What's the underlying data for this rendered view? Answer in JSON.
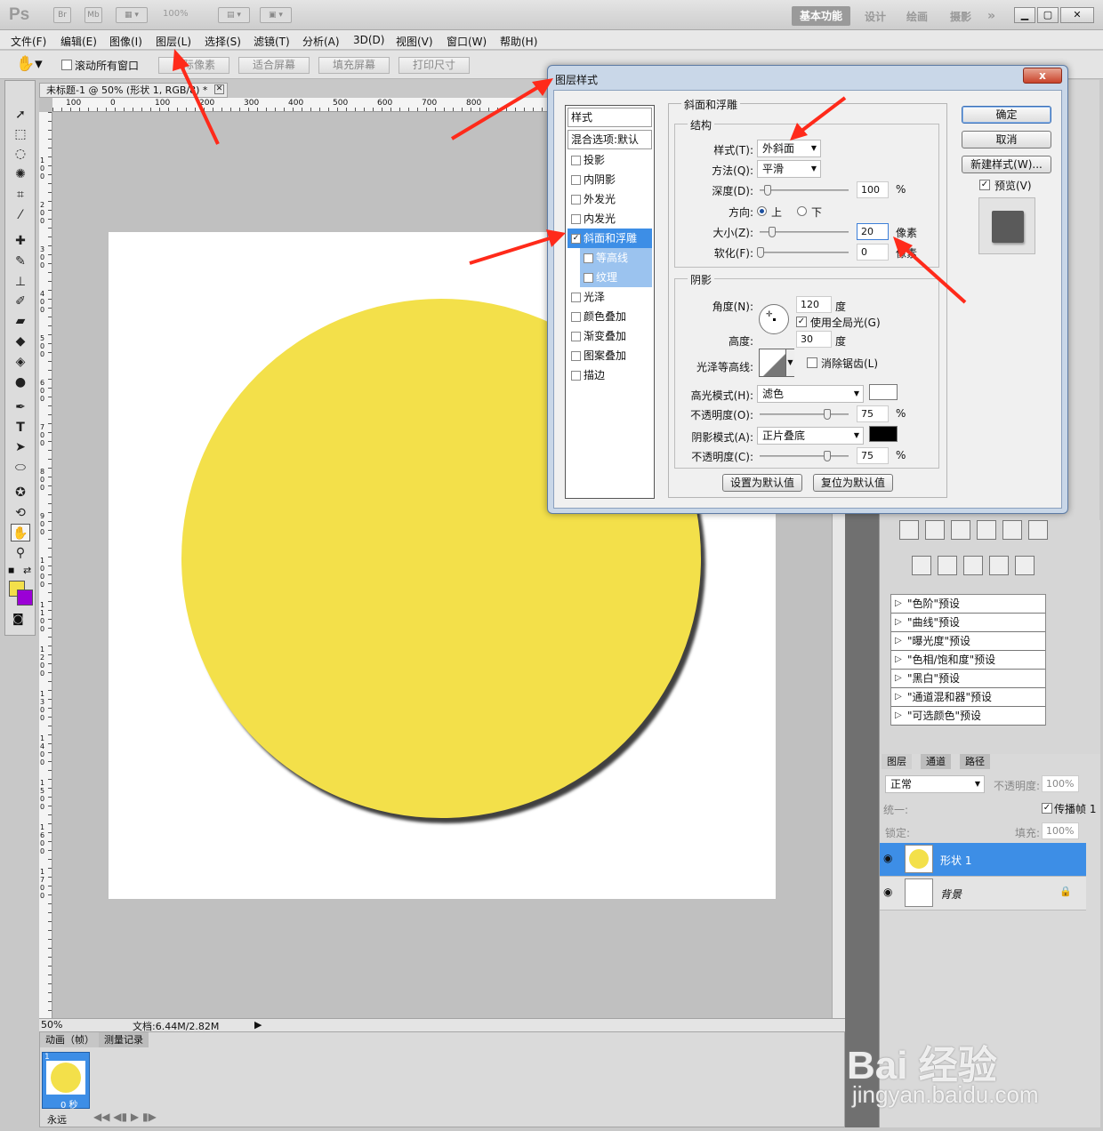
{
  "app": {
    "logo": "Ps",
    "bridge": "Br",
    "minibridge": "Mb",
    "zoom": "100%",
    "workspaces": [
      "基本功能",
      "设计",
      "绘画",
      "摄影"
    ],
    "more": "»"
  },
  "menu": [
    "文件(F)",
    "编辑(E)",
    "图像(I)",
    "图层(L)",
    "选择(S)",
    "滤镜(T)",
    "分析(A)",
    "3D(D)",
    "视图(V)",
    "窗口(W)",
    "帮助(H)"
  ],
  "options": {
    "scroll_all": "滚动所有窗口",
    "actual_pixels": "实际像素",
    "fit_screen": "适合屏幕",
    "fill_screen": "填充屏幕",
    "print_size": "打印尺寸"
  },
  "document": {
    "tab_title": "未标题-1 @ 50% (形状 1, RGB/8) *",
    "h_ruler": [
      "100",
      "0",
      "100",
      "200",
      "300",
      "400",
      "500",
      "600",
      "700",
      "800"
    ],
    "v_ruler": [
      "1",
      "2",
      "3",
      "4",
      "5",
      "6",
      "7",
      "8",
      "9",
      "10",
      "11",
      "12",
      "13",
      "14",
      "15",
      "16",
      "17"
    ],
    "status_zoom": "50%",
    "status_doc": "文档:6.44M/2.82M"
  },
  "colors": {
    "foreground": "#f3e04a",
    "background": "#9b00d6",
    "accent": "#3d8ee6",
    "arrow": "#ff2a1a"
  },
  "animation": {
    "tab_animation": "动画（帧）",
    "tab_history": "测量记录",
    "frame_number": "1",
    "frame_time": "0 秒",
    "loop": "永远"
  },
  "dialog": {
    "title": "图层样式",
    "close": "x",
    "styles_header": "样式",
    "blend_options": "混合选项:默认",
    "styles": [
      {
        "label": "投影",
        "checked": false
      },
      {
        "label": "内阴影",
        "checked": false
      },
      {
        "label": "外发光",
        "checked": false
      },
      {
        "label": "内发光",
        "checked": false
      },
      {
        "label": "斜面和浮雕",
        "checked": true
      },
      {
        "label": "等高线",
        "checked": false
      },
      {
        "label": "纹理",
        "checked": false
      },
      {
        "label": "光泽",
        "checked": false
      },
      {
        "label": "颜色叠加",
        "checked": false
      },
      {
        "label": "渐变叠加",
        "checked": false
      },
      {
        "label": "图案叠加",
        "checked": false
      },
      {
        "label": "描边",
        "checked": false
      }
    ],
    "section_title": "斜面和浮雕",
    "structure": {
      "legend": "结构",
      "style_label": "样式(T):",
      "style_value": "外斜面",
      "method_label": "方法(Q):",
      "method_value": "平滑",
      "depth_label": "深度(D):",
      "depth_value": "100",
      "percent": "%",
      "direction_label": "方向:",
      "direction_up": "上",
      "direction_down": "下",
      "size_label": "大小(Z):",
      "size_value": "20",
      "size_unit": "像素",
      "soften_label": "软化(F):",
      "soften_value": "0",
      "soften_unit": "像素"
    },
    "shading": {
      "legend": "阴影",
      "angle_label": "角度(N):",
      "angle_value": "120",
      "degree": "度",
      "global_light": "使用全局光(G)",
      "altitude_label": "高度:",
      "altitude_value": "30",
      "gloss_label": "光泽等高线:",
      "anti_alias": "消除锯齿(L)",
      "highlight_label": "高光模式(H):",
      "highlight_value": "滤色",
      "hl_opacity_label": "不透明度(O):",
      "hl_opacity_value": "75",
      "shadow_label": "阴影模式(A):",
      "shadow_value": "正片叠底",
      "sh_opacity_label": "不透明度(C):",
      "sh_opacity_value": "75"
    },
    "set_default": "设置为默认值",
    "reset_default": "复位为默认值",
    "ok": "确定",
    "cancel": "取消",
    "new_style": "新建样式(W)...",
    "preview": "预览(V)"
  },
  "adjustments": {
    "presets": [
      "\"色阶\"预设",
      "\"曲线\"预设",
      "\"曝光度\"预设",
      "\"色相/饱和度\"预设",
      "\"黑白\"预设",
      "\"通道混和器\"预设",
      "\"可选颜色\"预设"
    ]
  },
  "layers": {
    "tabs": [
      "图层",
      "通道",
      "路径"
    ],
    "blend_mode": "正常",
    "opacity_label": "不透明度:",
    "opacity_value": "100%",
    "unify_label": "统一:",
    "propagate": "传播帧 1",
    "lock_label": "锁定:",
    "fill_label": "填充:",
    "fill_value": "100%",
    "items": [
      {
        "name": "形状 1",
        "selected": true
      },
      {
        "name": "背景",
        "selected": false
      }
    ]
  },
  "watermark": {
    "main": "Bai 经验",
    "sub": "jingyan.baidu.com"
  }
}
